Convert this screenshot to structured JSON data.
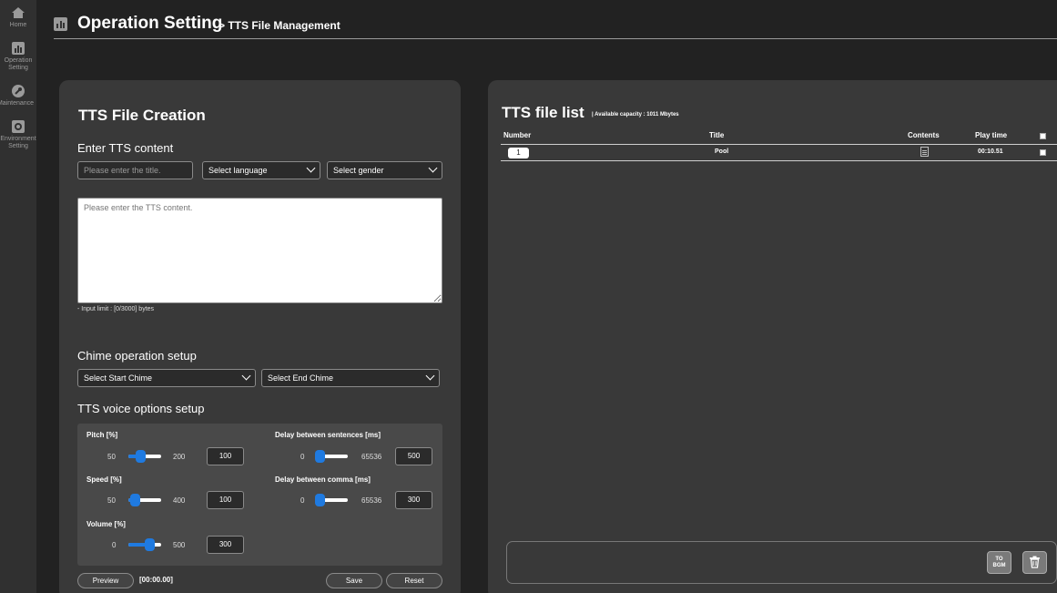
{
  "sidebar": {
    "items": [
      {
        "label": "Home",
        "icon": "home-icon"
      },
      {
        "label": "Operation\nSetting",
        "icon": "chart-icon"
      },
      {
        "label": "Maintenance",
        "icon": "wrench-icon"
      },
      {
        "label": "Environment\nSetting",
        "icon": "gear-icon"
      }
    ]
  },
  "header": {
    "title": "Operation Setting",
    "subtitle": "> TTS File Management"
  },
  "creation": {
    "title": "TTS File Creation",
    "enter_heading": "Enter TTS content",
    "title_placeholder": "Please enter the title.",
    "language_select": "Select language",
    "gender_select": "Select gender",
    "content_placeholder": "Please enter the TTS content.",
    "input_limit": "- Input limit : [0/3000] bytes",
    "chime_heading": "Chime operation setup",
    "start_chime": "Select Start Chime",
    "end_chime": "Select End Chime",
    "voice_heading": "TTS voice options setup",
    "options": {
      "pitch": {
        "label": "Pitch [%]",
        "min": "50",
        "max": "200",
        "value": "100"
      },
      "speed": {
        "label": "Speed [%]",
        "min": "50",
        "max": "400",
        "value": "100"
      },
      "volume": {
        "label": "Volume [%]",
        "min": "0",
        "max": "500",
        "value": "300"
      },
      "delay_sentences": {
        "label": "Delay between sentences [ms]",
        "min": "0",
        "max": "65536",
        "value": "500"
      },
      "delay_comma": {
        "label": "Delay between comma [ms]",
        "min": "0",
        "max": "65536",
        "value": "300"
      }
    },
    "preview_label": "Preview",
    "preview_time": "[00:00.00]",
    "save_label": "Save",
    "reset_label": "Reset"
  },
  "file_list": {
    "title": "TTS file list",
    "capacity": "| Available capacity : 1011 Mbytes",
    "columns": [
      "Number",
      "Title",
      "Contents",
      "Play time"
    ],
    "rows": [
      {
        "number": "1",
        "title": "Pool",
        "play_time": "00:10.51"
      }
    ],
    "to_bgm_label": "TO\nBGM"
  }
}
